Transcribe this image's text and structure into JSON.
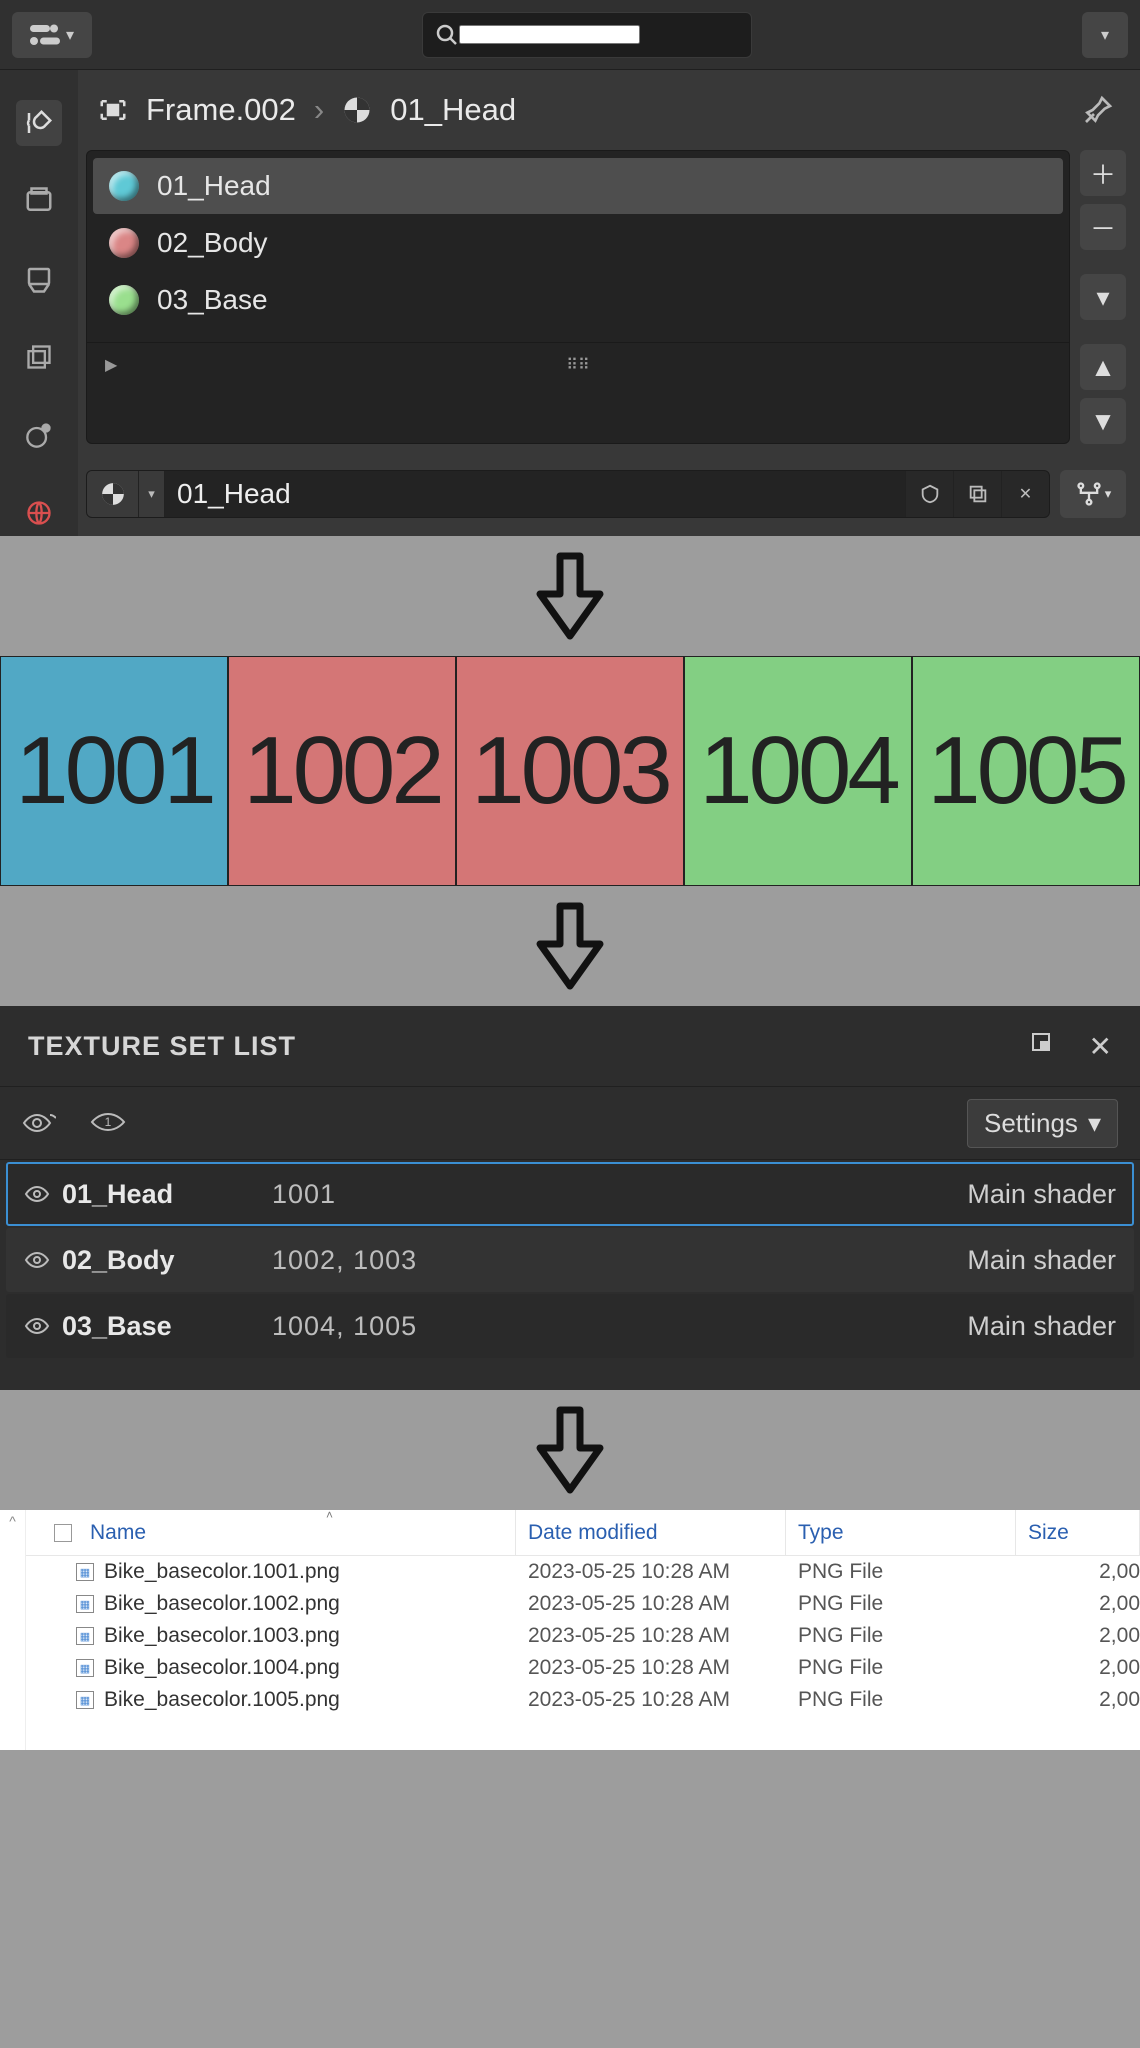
{
  "panel1": {
    "breadcrumb": {
      "frame": "Frame.002",
      "item": "01_Head"
    },
    "search_placeholder": "",
    "materials": [
      {
        "label": "01_Head",
        "color": "#5fc9d6",
        "selected": true
      },
      {
        "label": "02_Body",
        "color": "#da8686",
        "selected": false
      },
      {
        "label": "03_Base",
        "color": "#9adf8e",
        "selected": false
      }
    ],
    "field_value": "01_Head"
  },
  "tiles": [
    {
      "label": "1001",
      "cls": "blue"
    },
    {
      "label": "1002",
      "cls": "red"
    },
    {
      "label": "1003",
      "cls": "red"
    },
    {
      "label": "1004",
      "cls": "green"
    },
    {
      "label": "1005",
      "cls": "green"
    }
  ],
  "panel2": {
    "title": "TEXTURE SET LIST",
    "settings_label": "Settings",
    "rows": [
      {
        "name": "01_Head",
        "udims": "1001",
        "shader": "Main shader",
        "selected": true
      },
      {
        "name": "02_Body",
        "udims": "1002, 1003",
        "shader": "Main shader",
        "selected": false
      },
      {
        "name": "03_Base",
        "udims": "1004, 1005",
        "shader": "Main shader",
        "selected": false
      }
    ]
  },
  "panel3": {
    "cols": {
      "name": "Name",
      "date": "Date modified",
      "type": "Type",
      "size": "Size"
    },
    "rows": [
      {
        "name": "Bike_basecolor.1001.png",
        "date": "2023-05-25 10:28 AM",
        "type": "PNG File",
        "size": "2,00"
      },
      {
        "name": "Bike_basecolor.1002.png",
        "date": "2023-05-25 10:28 AM",
        "type": "PNG File",
        "size": "2,00"
      },
      {
        "name": "Bike_basecolor.1003.png",
        "date": "2023-05-25 10:28 AM",
        "type": "PNG File",
        "size": "2,00"
      },
      {
        "name": "Bike_basecolor.1004.png",
        "date": "2023-05-25 10:28 AM",
        "type": "PNG File",
        "size": "2,00"
      },
      {
        "name": "Bike_basecolor.1005.png",
        "date": "2023-05-25 10:28 AM",
        "type": "PNG File",
        "size": "2,00"
      }
    ]
  }
}
